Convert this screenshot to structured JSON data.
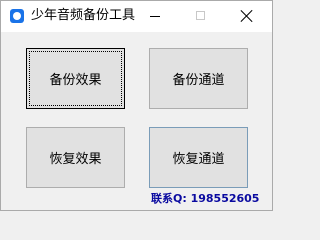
{
  "window": {
    "title": "少年音频备份工具",
    "app_icon": "app-logo-icon",
    "controls": {
      "minimize_icon": "minimize-icon",
      "maximize_icon": "maximize-icon",
      "close_icon": "close-icon"
    }
  },
  "buttons": {
    "backup_effects": "备份效果",
    "backup_channels": "备份通道",
    "restore_effects": "恢复效果",
    "restore_channels": "恢复通道"
  },
  "contact": {
    "text": "联系Q: 198552605"
  },
  "colors": {
    "accent_text": "#0a0aa0",
    "app_icon": "#1a73e8"
  }
}
